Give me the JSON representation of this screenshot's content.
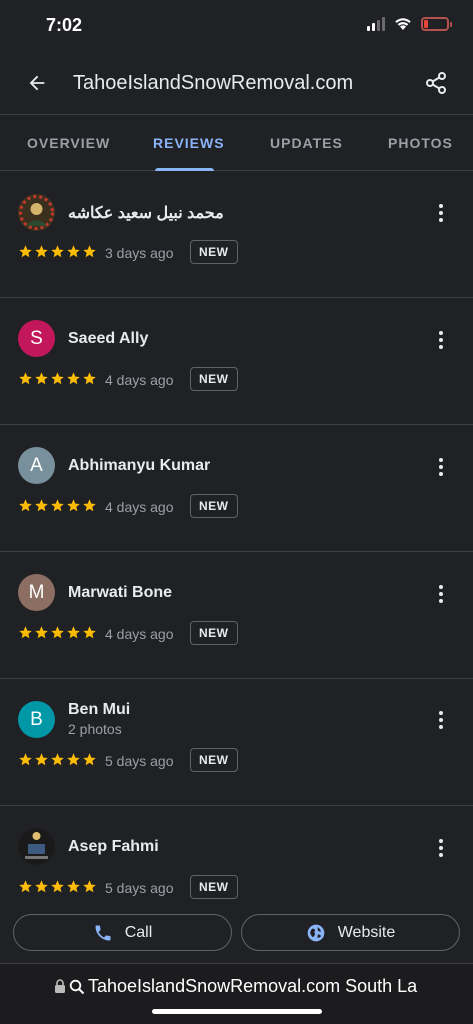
{
  "status_bar": {
    "time": "7:02"
  },
  "app_bar": {
    "title": "TahoeIslandSnowRemoval.com"
  },
  "tabs": [
    {
      "label": "OVERVIEW",
      "active": false
    },
    {
      "label": "REVIEWS",
      "active": true
    },
    {
      "label": "UPDATES",
      "active": false
    },
    {
      "label": "PHOTOS",
      "active": false
    }
  ],
  "reviews": [
    {
      "name": "محمد نبيل سعيد عكاشه",
      "avatar_letter": "",
      "avatar_color": "#5a4a2e",
      "sub": "",
      "rating": 5,
      "when": "3 days ago",
      "badge": "NEW"
    },
    {
      "name": "Saeed Ally",
      "avatar_letter": "S",
      "avatar_color": "#c2185b",
      "sub": "",
      "rating": 5,
      "when": "4 days ago",
      "badge": "NEW"
    },
    {
      "name": "Abhimanyu Kumar",
      "avatar_letter": "A",
      "avatar_color": "#78909c",
      "sub": "",
      "rating": 5,
      "when": "4 days ago",
      "badge": "NEW"
    },
    {
      "name": "Marwati Bone",
      "avatar_letter": "M",
      "avatar_color": "#8d6e63",
      "sub": "",
      "rating": 5,
      "when": "4 days ago",
      "badge": "NEW"
    },
    {
      "name": "Ben Mui",
      "avatar_letter": "B",
      "avatar_color": "#0097a7",
      "sub": "2 photos",
      "rating": 5,
      "when": "5 days ago",
      "badge": "NEW"
    },
    {
      "name": "Asep Fahmi",
      "avatar_letter": "",
      "avatar_color": "#2b2b2b",
      "sub": "",
      "rating": 5,
      "when": "5 days ago",
      "badge": "NEW"
    }
  ],
  "actions": {
    "call_label": "Call",
    "website_label": "Website"
  },
  "url_bar": {
    "text": "TahoeIslandSnowRemoval.com South La"
  },
  "colors": {
    "accent": "#8ab4f8",
    "star": "#fbbc04",
    "background": "#202124"
  },
  "icons": [
    "back-arrow-icon",
    "share-icon",
    "more-vert-icon",
    "star-icon",
    "phone-icon",
    "globe-icon",
    "lock-icon",
    "search-icon"
  ]
}
